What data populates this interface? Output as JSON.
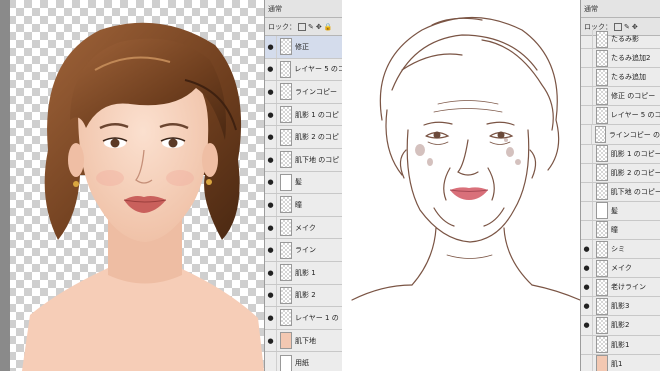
{
  "left_panel": {
    "blend_mode": "通常",
    "lock_label": "ロック：",
    "layers": [
      {
        "name": "修正",
        "eye": true,
        "thumb": "checker",
        "selected": true
      },
      {
        "name": "レイヤー 5 のコ",
        "eye": true,
        "thumb": "checker"
      },
      {
        "name": "ラインコピー",
        "eye": true,
        "thumb": "checker"
      },
      {
        "name": "肌影 1 のコピ",
        "eye": true,
        "thumb": "checker"
      },
      {
        "name": "肌影 2 のコピ",
        "eye": true,
        "thumb": "checker"
      },
      {
        "name": "肌下地 のコピ",
        "eye": true,
        "thumb": "checker"
      },
      {
        "name": "髪",
        "eye": true,
        "thumb": "hair"
      },
      {
        "name": "瞳",
        "eye": true,
        "thumb": "checker"
      },
      {
        "name": "メイク",
        "eye": true,
        "thumb": "checker"
      },
      {
        "name": "ライン",
        "eye": true,
        "thumb": "checker"
      },
      {
        "name": "肌影 1",
        "eye": true,
        "thumb": "checker"
      },
      {
        "name": "肌影 2",
        "eye": true,
        "thumb": "checker"
      },
      {
        "name": "レイヤー 1 の",
        "eye": true,
        "thumb": "checker"
      },
      {
        "name": "肌下地",
        "eye": true,
        "thumb": "skin"
      },
      {
        "name": "用紙",
        "eye": false,
        "thumb": "plain"
      }
    ]
  },
  "right_panel": {
    "blend_mode": "通常",
    "lock_label": "ロック：",
    "layers": [
      {
        "name": "たるみ影",
        "eye": false,
        "thumb": "checker"
      },
      {
        "name": "たるみ追加2",
        "eye": false,
        "thumb": "checker"
      },
      {
        "name": "たるみ追加",
        "eye": false,
        "thumb": "checker"
      },
      {
        "name": "修正 のコピー",
        "eye": false,
        "thumb": "checker"
      },
      {
        "name": "レイヤー 5 のコ",
        "eye": false,
        "thumb": "checker"
      },
      {
        "name": "ラインコピー のコ",
        "eye": false,
        "thumb": "checker"
      },
      {
        "name": "肌影 1 のコピー",
        "eye": false,
        "thumb": "checker"
      },
      {
        "name": "肌影 2 のコピー",
        "eye": false,
        "thumb": "checker"
      },
      {
        "name": "肌下地 のコピー",
        "eye": false,
        "thumb": "checker"
      },
      {
        "name": "髪",
        "eye": false,
        "thumb": "hair"
      },
      {
        "name": "瞳",
        "eye": false,
        "thumb": "checker"
      },
      {
        "name": "シミ",
        "eye": true,
        "thumb": "checker"
      },
      {
        "name": "メイク",
        "eye": true,
        "thumb": "checker"
      },
      {
        "name": "老けライン",
        "eye": true,
        "thumb": "checker"
      },
      {
        "name": "肌影3",
        "eye": true,
        "thumb": "checker"
      },
      {
        "name": "肌影2",
        "eye": true,
        "thumb": "checker"
      },
      {
        "name": "肌影1",
        "eye": false,
        "thumb": "checker"
      },
      {
        "name": "肌1",
        "eye": false,
        "thumb": "skin"
      }
    ]
  }
}
